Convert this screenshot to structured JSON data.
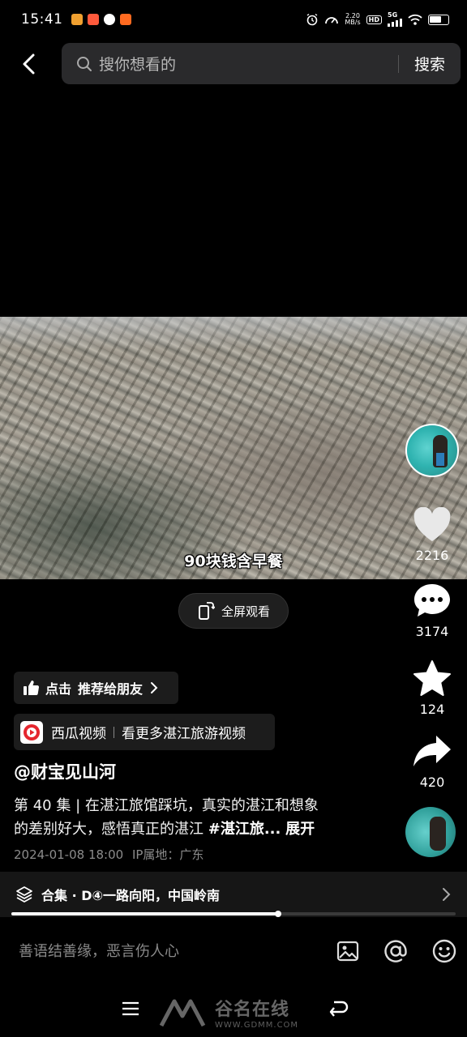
{
  "status_bar": {
    "time": "15:41",
    "net_speed_value": "2.20",
    "net_speed_unit": "MB/s",
    "hd_label": "HD",
    "network_label": "5G",
    "battery_level": 0.7
  },
  "search": {
    "placeholder": "搜你想看的",
    "button_label": "搜索"
  },
  "video": {
    "caption": "90块钱含早餐",
    "fullscreen_label": "全屏观看"
  },
  "rail": {
    "likes": "2216",
    "comments": "3174",
    "favorites": "124",
    "shares": "420"
  },
  "recommend": {
    "prefix": "点击",
    "label": "推荐给朋友"
  },
  "xigua": {
    "app_name": "西瓜视频",
    "link_text": "看更多湛江旅游视频"
  },
  "post": {
    "author": "@财宝见山河",
    "desc_line1": "第 40 集 | 在湛江旅馆踩坑，真实的湛江和想象",
    "desc_line2_text": "的差别好大，感悟真正的湛江 ",
    "desc_tag": "#湛江旅...",
    "desc_more": "展开",
    "date": "2024-01-08 18:00",
    "ip_label": "IP属地：广东"
  },
  "collection": {
    "label": "合集 · D④一路向阳，中国岭南",
    "progress": 0.6
  },
  "comment": {
    "placeholder": "善语结善缘，恶言伤人心"
  },
  "watermark": {
    "brand": "谷名在线",
    "url": "WWW.GDMM.COM"
  },
  "colors": {
    "background": "#000000",
    "chip_bg": "#1c1c1c",
    "search_bg": "#2a2a2c",
    "xigua_red": "#e5262e"
  }
}
